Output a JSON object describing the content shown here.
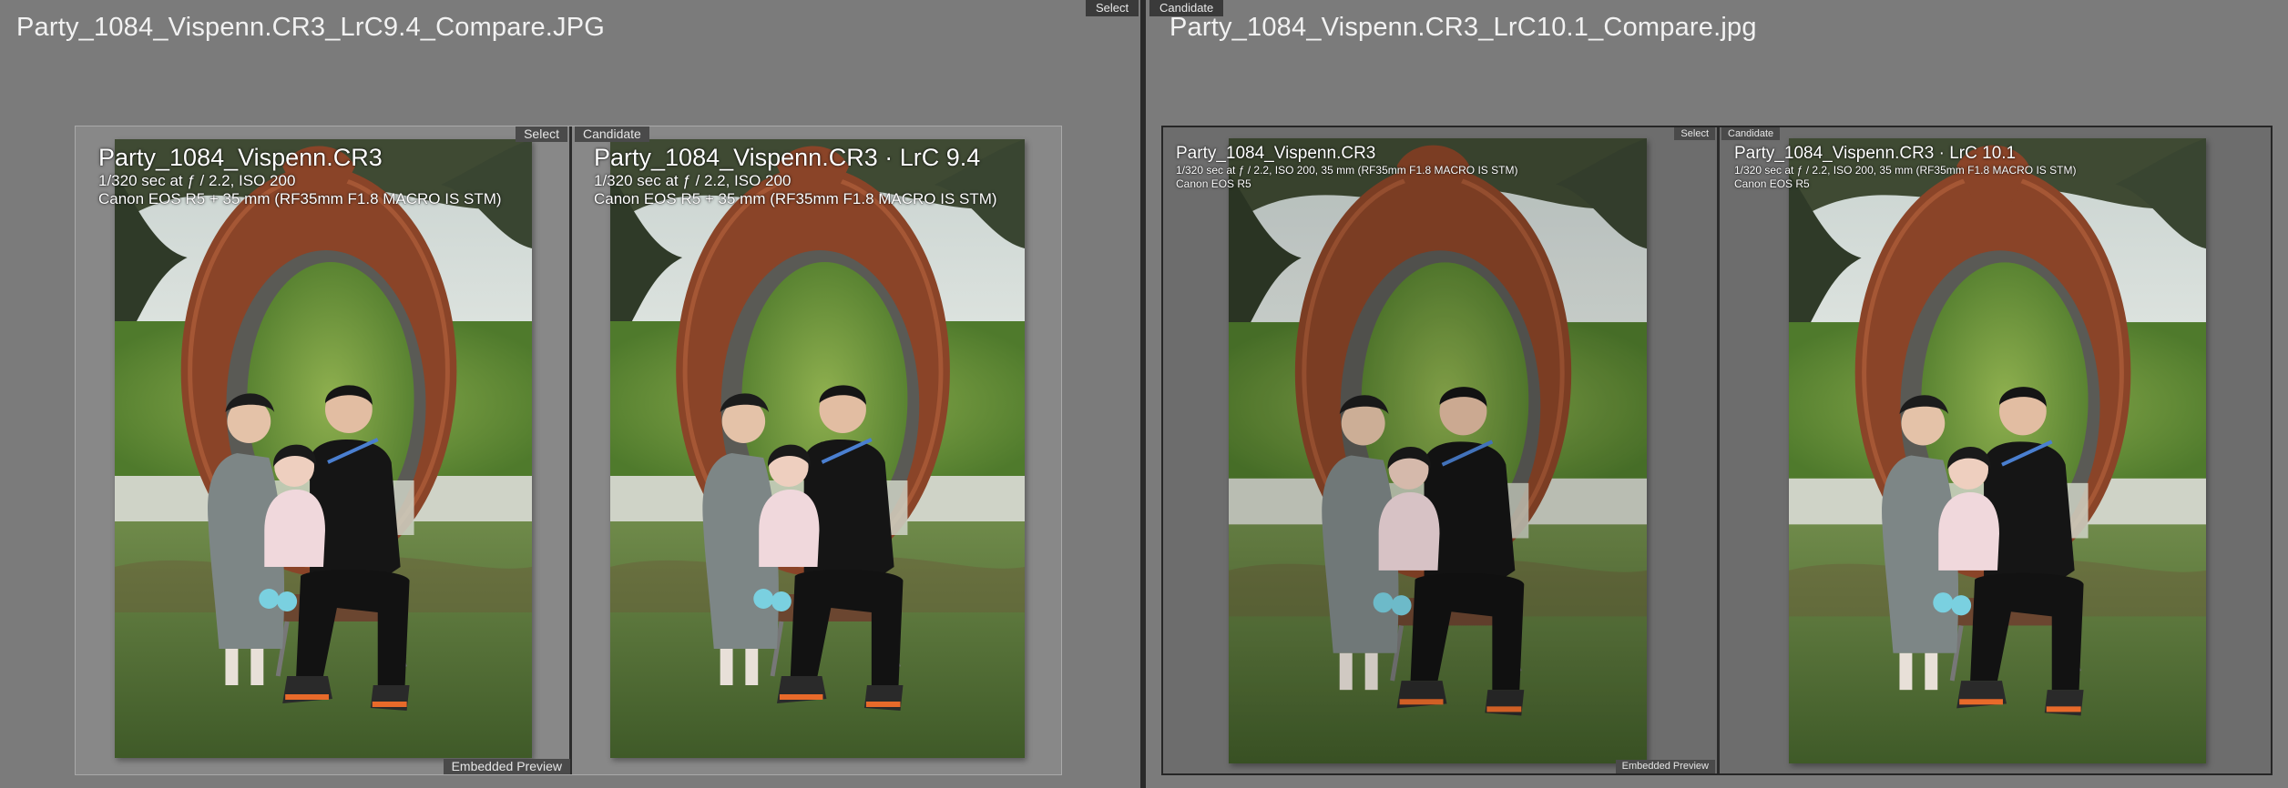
{
  "header": {
    "select_label": "Select",
    "candidate_label": "Candidate"
  },
  "left": {
    "title": "Party_1084_Vispenn.CR3_LrC9.4_Compare.JPG",
    "select": {
      "tag": "Select",
      "overlay_title": "Party_1084_Vispenn.CR3",
      "exposure": "1/320 sec at ƒ / 2.2, ISO 200",
      "camera": "Canon EOS R5 + 35 mm (RF35mm F1.8 MACRO IS STM)",
      "bottom_tag": "Embedded Preview"
    },
    "candidate": {
      "tag": "Candidate",
      "overlay_title": "Party_1084_Vispenn.CR3 · LrC 9.4",
      "exposure": "1/320 sec at ƒ / 2.2, ISO 200",
      "camera": "Canon EOS R5 + 35 mm (RF35mm F1.8 MACRO IS STM)"
    }
  },
  "right": {
    "title": "Party_1084_Vispenn.CR3_LrC10.1_Compare.jpg",
    "select": {
      "tag": "Select",
      "overlay_title": "Party_1084_Vispenn.CR3",
      "exposure": "1/320 sec at ƒ / 2.2, ISO 200, 35 mm (RF35mm F1.8 MACRO IS STM)",
      "camera": "Canon EOS R5",
      "bottom_tag": "Embedded Preview"
    },
    "candidate": {
      "tag": "Candidate",
      "overlay_title": "Party_1084_Vispenn.CR3 · LrC 10.1",
      "exposure": "1/320 sec at ƒ / 2.2, ISO 200, 35 mm (RF35mm F1.8 MACRO IS STM)",
      "camera": "Canon EOS R5"
    }
  }
}
